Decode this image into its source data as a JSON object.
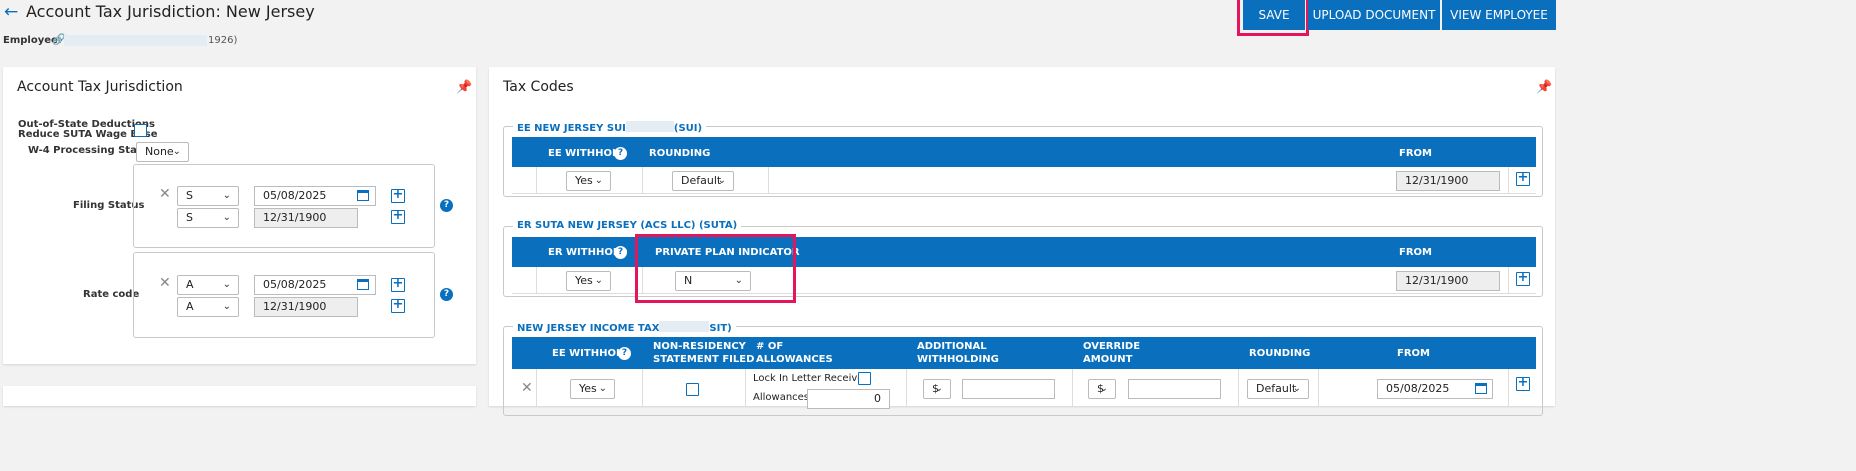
{
  "header": {
    "title": "Account Tax Jurisdiction: New Jersey",
    "employee_label": "Employee:",
    "employee_suffix": "1926)",
    "buttons": {
      "save": "SAVE",
      "upload": "UPLOAD DOCUMENT",
      "view": "VIEW EMPLOYEE"
    }
  },
  "left": {
    "title": "Account Tax Jurisdiction",
    "oos_label_1": "Out-of-State Deductions",
    "oos_label_2": "Reduce SUTA Wage Base",
    "w4_label": "W-4 Processing Status",
    "w4_value": "None",
    "filing_label": "Filing Status",
    "filing_rows": [
      {
        "value": "S",
        "date": "05/08/2025"
      },
      {
        "value": "S",
        "date": "12/31/1900"
      }
    ],
    "rate_label": "Rate code",
    "rate_rows": [
      {
        "value": "A",
        "date": "05/08/2025"
      },
      {
        "value": "A",
        "date": "12/31/1900"
      }
    ]
  },
  "right": {
    "title": "Tax Codes",
    "sui": {
      "legend_a": "EE NEW JERSEY SUI",
      "legend_b": "(SUI)",
      "col_withhold": "EE WITHHOLD",
      "col_rounding": "ROUNDING",
      "col_from": "FROM",
      "withhold": "Yes",
      "rounding": "Default",
      "from": "12/31/1900"
    },
    "suta": {
      "legend": "ER SUTA NEW JERSEY (ACS LLC) (SUTA)",
      "col_withhold": "ER WITHHOLD",
      "col_ppi": "PRIVATE PLAN INDICATOR",
      "col_from": "FROM",
      "withhold": "Yes",
      "ppi": "N",
      "from": "12/31/1900"
    },
    "sit": {
      "legend_a": "NEW JERSEY INCOME TAX",
      "legend_b": "SIT)",
      "col_withhold": "EE WITHHOLD",
      "col_nonres_1": "NON-RESIDENCY",
      "col_nonres_2": "STATEMENT FILED",
      "col_allow_1": "# OF",
      "col_allow_2": "ALLOWANCES",
      "col_addl_1": "ADDITIONAL",
      "col_addl_2": "WITHHOLDING",
      "col_override_1": "OVERRIDE",
      "col_override_2": "AMOUNT",
      "col_rounding": "ROUNDING",
      "col_from": "FROM",
      "withhold": "Yes",
      "lock_label": "Lock In Letter Received",
      "allowances_label": "Allowances",
      "allowances_value": "0",
      "addl_unit": "$",
      "override_unit": "$",
      "rounding": "Default",
      "from": "05/08/2025"
    }
  },
  "colors": {
    "accent": "#0a6fbd",
    "highlight": "#e3165b"
  }
}
